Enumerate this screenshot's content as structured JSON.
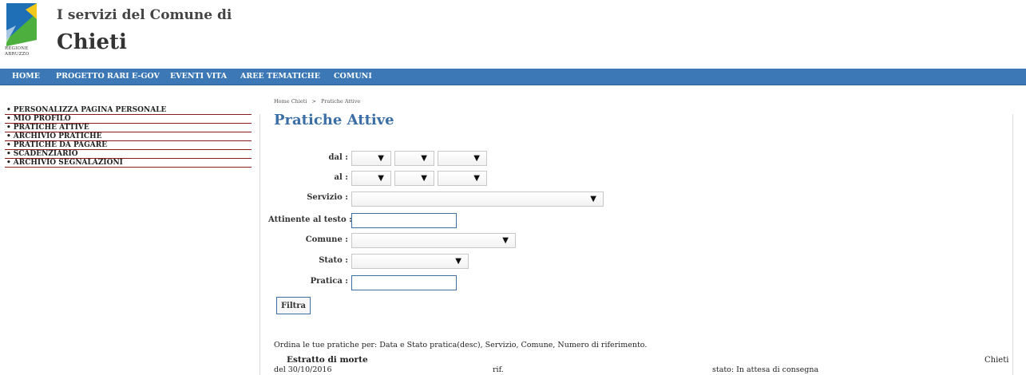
{
  "header": {
    "logo_text": "REGIONE ABRUZZO",
    "subtitle": "I servizi del Comune di",
    "title": "Chieti",
    "logo_colors": {
      "blue": "#1f6fb7",
      "green": "#4caf3e",
      "yellow": "#f2c81d"
    }
  },
  "nav": {
    "items": [
      "HOME",
      "PROGETTO RARI E-GOV",
      "EVENTI VITA",
      "AREE TEMATICHE",
      "COMUNI"
    ],
    "color": "#3b78b5"
  },
  "sidebar": {
    "items": [
      "PERSONALIZZA PAGINA PERSONALE",
      "MIO PROFILO",
      "PRATICHE ATTIVE",
      "ARCHIVIO PRATICHE",
      "PRATICHE DA PAGARE",
      "SCADENZIARIO",
      "ARCHIVIO SEGNALAZIONI"
    ],
    "bullet": "•",
    "border_color": "#8b1a1a"
  },
  "breadcrumb": {
    "home": "Home Chieti",
    "separator": ">",
    "current": "Pratiche Attive"
  },
  "page": {
    "title": "Pratiche Attive"
  },
  "form": {
    "dal_label": "dal :",
    "al_label": "al :",
    "servizio_label": "Servizio :",
    "attinente_label": "Attinente al testo :",
    "comune_label": "Comune :",
    "stato_label": "Stato :",
    "pratica_label": "Pratica :",
    "dropdown_arrow": "▼",
    "dal_values": [
      "",
      "",
      ""
    ],
    "al_values": [
      "",
      "",
      ""
    ],
    "servizio_value": "",
    "attinente_value": "",
    "comune_value": "",
    "stato_value": "",
    "pratica_value": "",
    "filter_button": "Filtra"
  },
  "results": {
    "sort_line": "Ordina le tue pratiche per: Data e Stato pratica(desc), Servizio, Comune, Numero di riferimento.",
    "items": [
      {
        "title": "Estratto di morte",
        "comune": "Chieti",
        "date": "del 30/10/2016",
        "rif": "rif.",
        "stato": "stato: In attesa di consegna"
      }
    ]
  }
}
